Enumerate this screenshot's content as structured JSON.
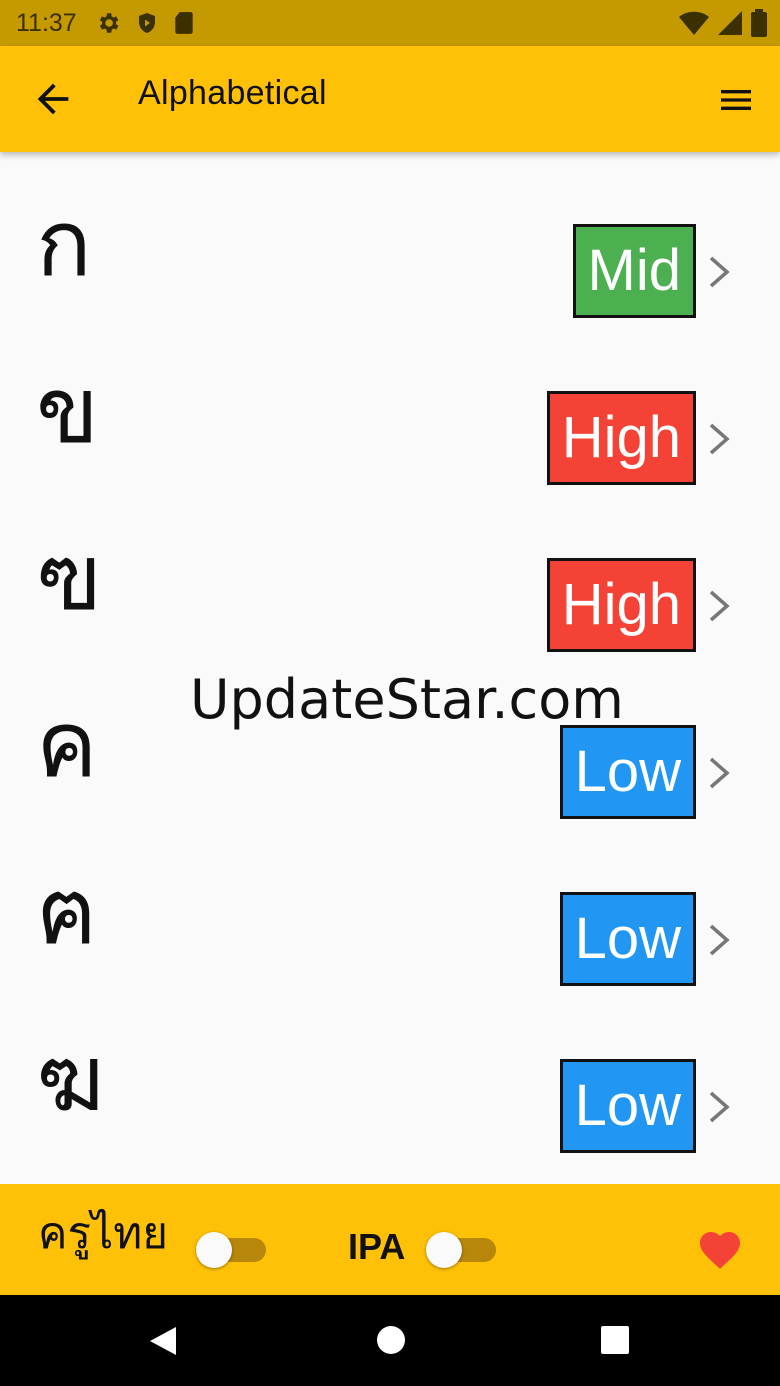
{
  "status_bar": {
    "time": "11:37",
    "left_icons": [
      "gear-icon",
      "shield-icon",
      "sd-card-icon"
    ],
    "right_icons": [
      "wifi-icon",
      "signal-icon",
      "battery-icon"
    ]
  },
  "app_bar": {
    "title": "Alphabetical",
    "back_icon": "arrow-left-icon",
    "menu_icon": "hamburger-menu-icon",
    "background": "#ffc107"
  },
  "letters": [
    {
      "char": "ก",
      "class": "Mid",
      "color": "#4caf50"
    },
    {
      "char": "ข",
      "class": "High",
      "color": "#f44336"
    },
    {
      "char": "ฃ",
      "class": "High",
      "color": "#f44336"
    },
    {
      "char": "ค",
      "class": "Low",
      "color": "#2196f3"
    },
    {
      "char": "ฅ",
      "class": "Low",
      "color": "#2196f3"
    },
    {
      "char": "ฆ",
      "class": "Low",
      "color": "#2196f3"
    }
  ],
  "watermark": "UpdateStar.com",
  "bottom_bar": {
    "thai_label": "ครูไทย",
    "thai_toggle_on": false,
    "ipa_label": "IPA",
    "ipa_toggle_on": false,
    "favorite_icon": "heart-icon",
    "favorite_color": "#f44336"
  },
  "nav_bar": {
    "buttons": [
      "back-triangle-icon",
      "home-circle-icon",
      "recents-square-icon"
    ]
  }
}
